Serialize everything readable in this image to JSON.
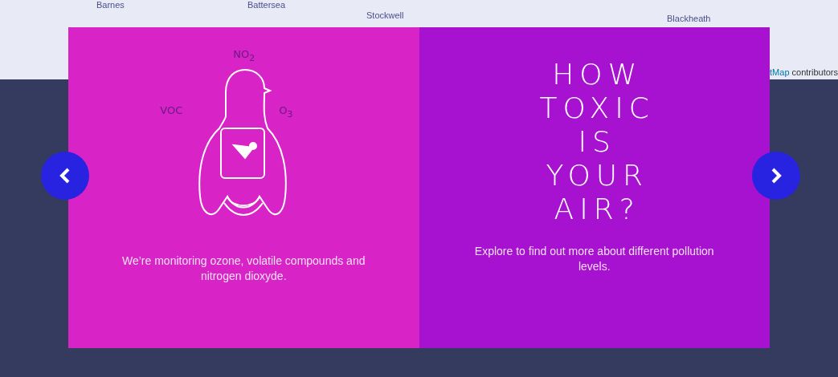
{
  "map": {
    "places": [
      "Barnes",
      "Battersea",
      "Stockwell",
      "Blackheath"
    ],
    "attribution_link": "tMap",
    "attribution_text": "contributors"
  },
  "slides": [
    {
      "kind": "diagram",
      "labels": {
        "top": "NO$_{2}$",
        "left": "VOC",
        "right": "O$_{3}$"
      },
      "caption": "We’re monitoring ozone, volatile compounds and nitrogen dioxyde."
    },
    {
      "kind": "title",
      "title_lines": [
        "HOW",
        "TOXIC",
        "IS",
        "YOUR",
        "AIR?"
      ],
      "caption": "Explore to find out more about different pollution levels."
    }
  ]
}
